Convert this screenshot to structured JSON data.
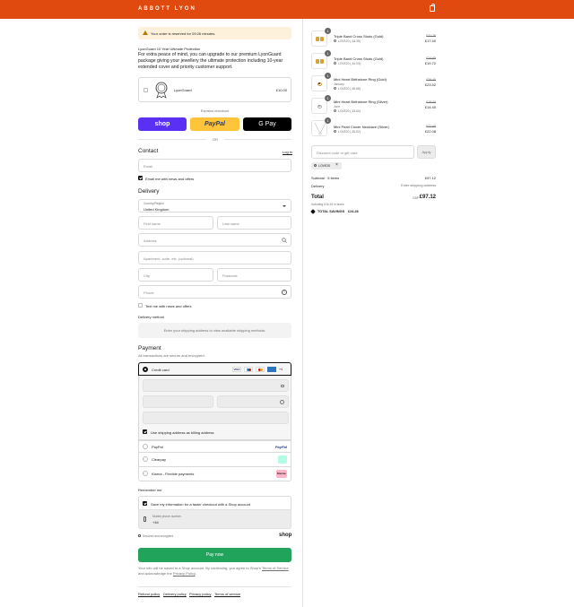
{
  "header": {
    "brand": "ABBOTT LYON",
    "cart_icon": "bag-icon"
  },
  "timer": {
    "text": "Your order is reserved for 09:26 minutes."
  },
  "lyonguard": {
    "title": "LyonGuard 10 Year Ultimate Protection",
    "description": "For extra peace of mind, you can upgrade to our premium LyonGuard package giving your jewellery the ultimate protection including 10-year extended cover and priority customer support.",
    "item_label": "LyonGuard",
    "price": "£10.00"
  },
  "express": {
    "title": "Express checkout",
    "shop_label": "shop",
    "paypal_label": "PayPal",
    "gpay_label": "G Pay",
    "or": "OR"
  },
  "contact": {
    "title": "Contact",
    "login": "Log in",
    "email_placeholder": "Email",
    "news_label": "Email me with news and offers"
  },
  "delivery": {
    "title": "Delivery",
    "country_label": "Country/Region",
    "country_value": "United Kingdom",
    "first_name": "First name",
    "last_name": "Last name",
    "address": "Address",
    "apartment": "Apartment, suite, etc. (optional)",
    "city": "City",
    "postcode": "Postcode",
    "phone": "Phone",
    "text_label": "Text me with news and offers",
    "method_title": "Delivery method",
    "method_info": "Enter your shipping address to view available shipping methods."
  },
  "payment": {
    "title": "Payment",
    "subtitle": "All transactions are secure and encrypted.",
    "credit_card": "Credit card",
    "more_cards": "+4",
    "billing_label": "Use shipping address as billing address",
    "paypal": "PayPal",
    "paypal_logo": "PayPal",
    "clearpay": "Clearpay",
    "klarna": "Klarna - Flexible payments",
    "klarna_logo": "Klarna."
  },
  "remember": {
    "title": "Remember me",
    "save_label": "Save my information for a faster checkout with a Shop account",
    "mobile_label": "Mobile phone number",
    "mobile_value": "+44",
    "secure": "Secured and encrypted",
    "shop_logo": "shop"
  },
  "pay_now": "Pay now",
  "legal": {
    "text_before": "Your info will be saved to a Shop account. By continuing, you agree to Shop's ",
    "terms": "Terms of Service",
    "text_mid": " and acknowledge the ",
    "privacy": "Privacy Policy",
    "text_after": "."
  },
  "footer": {
    "links": [
      "Refund policy",
      "Delivery policy",
      "Privacy policy",
      "Terms of service"
    ]
  },
  "cart": {
    "items": [
      {
        "qty": "1",
        "name": "Triple Band Cross Studs (Gold)",
        "variant": "",
        "discount": "LOVE20 (-£4.35)",
        "original": "£21.75",
        "price": "£17.40"
      },
      {
        "qty": "1",
        "name": "Triple Band Cross Studs (Gold)",
        "variant": "",
        "discount": "LOVE20 (-£4.93)",
        "original": "£24.65",
        "price": "£19.72"
      },
      {
        "qty": "1",
        "name": "Mini Heart Birthstone Ring (Gold)",
        "variant": "January",
        "discount": "LOVE20 (-£5.88)",
        "original": "£29.40",
        "price": "£23.52"
      },
      {
        "qty": "1",
        "name": "Mini Heart Birthstone Ring (Silver)",
        "variant": "June",
        "discount": "LOVE20 (-£3.60)",
        "original": "£18.00",
        "price": "£14.40"
      },
      {
        "qty": "1",
        "name": "Mini Pearl Clover Necklace (Silver)",
        "variant": "",
        "discount": "LOVE20 (-£5.52)",
        "original": "£27.60",
        "price": "£22.08"
      }
    ],
    "discount_placeholder": "Discount code or gift card",
    "apply": "Apply",
    "applied_code": "LOVE20",
    "subtotal_label": "Subtotal · 5 items",
    "subtotal_value": "£97.12",
    "delivery_label": "Delivery",
    "delivery_value": "Enter shipping address",
    "total_label": "Total",
    "currency": "GBP",
    "total_value": "£97.12",
    "taxes": "Including £16.19 in taxes",
    "savings_label": "TOTAL SAVINGS",
    "savings_value": "£24.28"
  },
  "colors": {
    "header": "#e04a0f",
    "shop": "#5a31f4",
    "paypal": "#ffc439",
    "pay_now": "#21a35c"
  }
}
